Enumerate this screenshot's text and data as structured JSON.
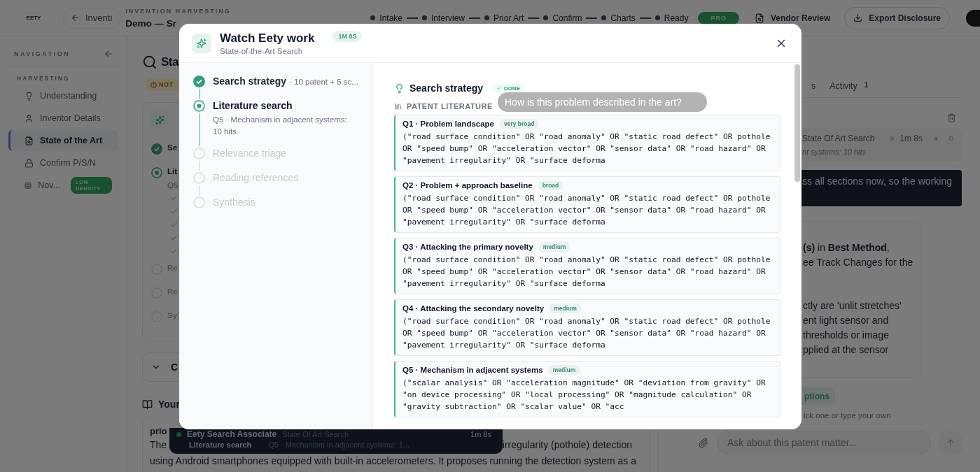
{
  "topbar": {
    "logo": "EETY",
    "back_button": "Inventi",
    "eyebrow": "INVENTION HARVESTING",
    "title": "Demo — Sr",
    "stepper": [
      {
        "label": "Intake"
      },
      {
        "label": "Interview"
      },
      {
        "label": "Prior Art"
      },
      {
        "label": "Confirm"
      },
      {
        "label": "Charts"
      },
      {
        "label": "Ready"
      }
    ],
    "plan_badge": "PRO",
    "vendor_button": "Vendor Review",
    "export_button": "Export Disclosure"
  },
  "sidebar": {
    "heading": "NAVIGATION",
    "section": "HARVESTING",
    "items": [
      {
        "label": "Understanding",
        "selected": false
      },
      {
        "label": "Inventor Details",
        "selected": false
      },
      {
        "label": "State of the Art",
        "selected": true
      },
      {
        "label": "Confirm P/S/N",
        "selected": false
      },
      {
        "label": "Nov...",
        "selected": false,
        "badge": "LOW DENSITY"
      }
    ]
  },
  "main": {
    "heading": "Sta",
    "status_badge": "NOT",
    "steps": [
      {
        "label": "Se",
        "kind": "done"
      },
      {
        "label": "Lit",
        "kind": "active",
        "detail": "Q5",
        "substeps": [
          {
            "done": true
          },
          {
            "done": true
          },
          {
            "done": true
          },
          {
            "done": true
          },
          {
            "done": true
          }
        ]
      },
      {
        "label": "Re",
        "kind": "pending"
      },
      {
        "label": "Re",
        "kind": "pending"
      },
      {
        "label": "Sy",
        "kind": "pending"
      }
    ],
    "collapsed_card": "C",
    "section_title": "Your",
    "reference": {
      "title": "prio",
      "line_1_start": "The",
      "line_1_end": "irregularity (pothole) detection",
      "line_2": "using Android smartphones equipped with built-in accelerometers. It proposes running the detection system as a"
    }
  },
  "toast": {
    "title": "Eety Search Associate",
    "context": "State Of Art Search",
    "elapsed": "1m 8s",
    "step": "Literature search",
    "detail": "Q5 · Mechanism in adjacent systems: 1..."
  },
  "right_panel": {
    "tabs": [
      {
        "label": "s",
        "selected": false
      },
      {
        "label": "Activity",
        "count": "1",
        "selected": false
      }
    ],
    "run_card": {
      "title": "State Of Art Search",
      "elapsed": "1m 8s",
      "detail": "nt systems: 10 hits"
    },
    "banner": "ss all sections now, so the working",
    "message": [
      [
        "**(s)** in **Best Method**,",
        "ee Track Changes for the"
      ],
      [
        "ctly are 'unlit stretches'",
        "ent light sensor and",
        "thresholds or image",
        "pplied at the sensor"
      ]
    ],
    "chip": "ptions",
    "hint": "ick one or type your own",
    "chat_placeholder": "Ask about this patent matter..."
  },
  "modal": {
    "title": "Watch Eety work",
    "subtitle": "State-of-the-Art Search",
    "elapsed_badge": "1M 8S",
    "steps": [
      {
        "label": "Search strategy",
        "kind": "done",
        "detail": "· 10 patent + 5 sc..."
      },
      {
        "label": "Literature search",
        "kind": "active",
        "detail": "Q5 · Mechanism in adjacent systems: 10 hits"
      },
      {
        "label": "Relevance triage",
        "kind": "pending"
      },
      {
        "label": "Reading references",
        "kind": "pending"
      },
      {
        "label": "Synthesis",
        "kind": "pending"
      }
    ],
    "section_title": "Search strategy",
    "section_status": "DONE",
    "tooltip": "How is this problem described in the art?",
    "subheading": "PATENT LITERATURE",
    "queries": [
      {
        "title": "Q1 · Problem landscape",
        "scope": "very broad",
        "query": "(\"road surface condition\" OR \"road anomaly\" OR \"static road defect\" OR pothole OR \"speed bump\" OR \"acceleration vector\" OR \"sensor data\" OR \"road hazard\" OR \"pavement irregularity\" OR \"surface deforma"
      },
      {
        "title": "Q2 · Problem + approach baseline",
        "scope": "broad",
        "query": "(\"road surface condition\" OR \"road anomaly\" OR \"static road defect\" OR pothole OR \"speed bump\" OR \"acceleration vector\" OR \"sensor data\" OR \"road hazard\" OR \"pavement irregularity\" OR \"surface deforma"
      },
      {
        "title": "Q3 · Attacking the primary novelty",
        "scope": "medium",
        "query": "(\"road surface condition\" OR \"road anomaly\" OR \"static road defect\" OR pothole OR \"speed bump\" OR \"acceleration vector\" OR \"sensor data\" OR \"road hazard\" OR \"pavement irregularity\" OR \"surface deforma"
      },
      {
        "title": "Q4 · Attacking the secondary novelty",
        "scope": "medium",
        "query": "(\"road surface condition\" OR \"road anomaly\" OR \"static road defect\" OR pothole OR \"speed bump\" OR \"acceleration vector\" OR \"sensor data\" OR \"road hazard\" OR \"pavement irregularity\" OR \"surface deforma"
      },
      {
        "title": "Q5 · Mechanism in adjacent systems",
        "scope": "medium",
        "query": "(\"scalar analysis\" OR \"acceleration magnitude\" OR \"deviation from gravity\" OR \"on device processing\" OR \"local processing\" OR \"magnitude calculation\" OR \"gravity subtraction\" OR \"scalar value\" OR \"acc"
      }
    ]
  }
}
